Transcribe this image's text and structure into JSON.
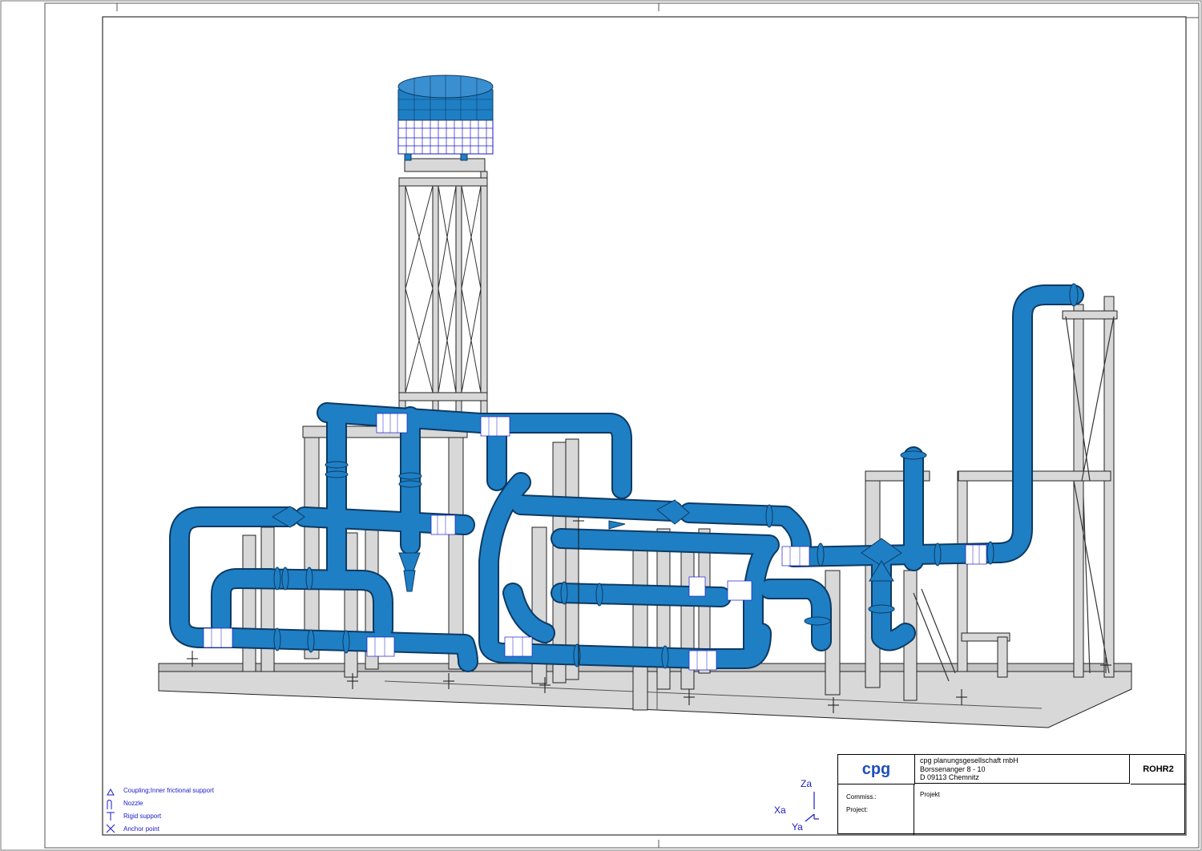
{
  "legend": [
    {
      "label": "Coupling;Inner frictional support",
      "icon": "coupling-icon"
    },
    {
      "label": "Nozzle",
      "icon": "nozzle-icon"
    },
    {
      "label": "Rigid support",
      "icon": "rigid-support-icon"
    },
    {
      "label": "Anchor point",
      "icon": "anchor-point-icon"
    }
  ],
  "axes": {
    "z": "Za",
    "x": "Xa",
    "y": "Ya"
  },
  "title_block": {
    "logo": "cpg",
    "company_line1": "cpg planungsgesellschaft mbH",
    "company_line2": "Borssenanger 8 - 10",
    "company_line3": "D 09113 Chemnitz",
    "program": "ROHR2",
    "commiss_label": "Commiss.:",
    "project_label": "Project:",
    "project_value": "Projekt"
  },
  "colors": {
    "pipe": "#1f7fc4",
    "pipe_dark": "#0d3a63",
    "steel": "#d9d9d9",
    "steel_edge": "#2a2a2a",
    "legend_text": "#1a1acc",
    "mesh": "#1a1acc"
  }
}
